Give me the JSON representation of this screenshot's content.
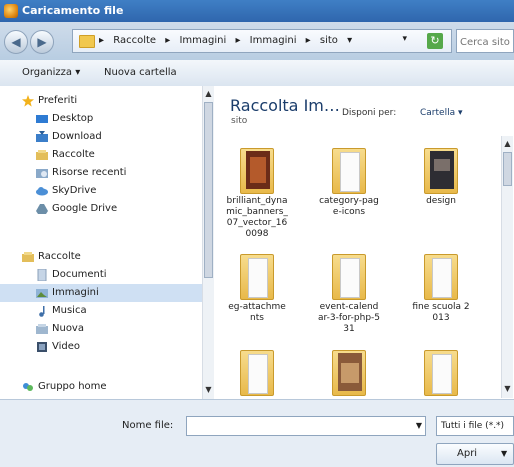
{
  "window": {
    "title": "Caricamento file"
  },
  "navigation": {
    "breadcrumbs": [
      "Raccolte",
      "Immagini",
      "Immagini",
      "sito"
    ],
    "search_placeholder": "Cerca sito"
  },
  "toolbar": {
    "organize_label": "Organizza",
    "new_folder_label": "Nuova cartella"
  },
  "sidebar": {
    "favorites_header": "Preferiti",
    "favorites": [
      "Desktop",
      "Download",
      "Raccolte",
      "Risorse recenti",
      "SkyDrive",
      "Google Drive"
    ],
    "libraries_header": "Raccolte",
    "libraries": [
      "Documenti",
      "Immagini",
      "Musica",
      "Nuova",
      "Video"
    ],
    "homegroup": "Gruppo home"
  },
  "content": {
    "library_title": "Raccolta Im…",
    "library_subtitle": "sito",
    "arrange_label": "Disponi per:",
    "arrange_value": "Cartella",
    "items": [
      {
        "name": "brilliant_dynamic_banners_07_vector_160098"
      },
      {
        "name": "category-page-icons"
      },
      {
        "name": "design"
      },
      {
        "name": "eg-attachments"
      },
      {
        "name": "event-calendar-3-for-php-531"
      },
      {
        "name": "fine scuola 2013"
      },
      {
        "name": ""
      },
      {
        "name": ""
      },
      {
        "name": ""
      }
    ]
  },
  "footer": {
    "filename_label": "Nome file:",
    "filename_value": "",
    "filetype_value": "Tutti i file (*.*)",
    "open_label": "Apri"
  },
  "colors": {
    "titlebar": "#2f66ad",
    "folder": "#e8b94a",
    "selection": "#cfe0f3"
  }
}
